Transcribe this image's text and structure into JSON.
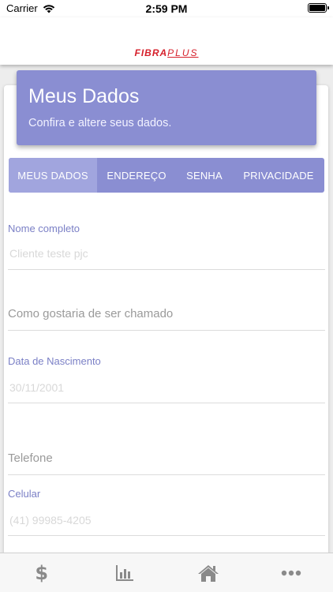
{
  "status_bar": {
    "carrier": "Carrier",
    "time": "2:59 PM"
  },
  "header": {
    "logo_main": "FIBRA",
    "logo_plus": "PLUS",
    "brand_color": "#d6202b"
  },
  "banner": {
    "title": "Meus Dados",
    "subtitle": "Confira e altere seus dados.",
    "color": "#8a8ed2"
  },
  "tabs": [
    {
      "label": "MEUS DADOS",
      "active": true
    },
    {
      "label": "ENDEREÇO",
      "active": false
    },
    {
      "label": "SENHA",
      "active": false
    },
    {
      "label": "PRIVACIDADE",
      "active": false
    }
  ],
  "form": {
    "full_name": {
      "label": "Nome completo",
      "value": "Cliente teste pjc"
    },
    "nickname": {
      "placeholder": "Como gostaria de ser chamado"
    },
    "birth_date": {
      "label": "Data de Nascimento",
      "value": "30/11/2001"
    },
    "phone": {
      "placeholder": "Telefone"
    },
    "mobile": {
      "label": "Celular",
      "value": "(41) 99985-4205"
    }
  },
  "tabbar": {
    "items": [
      {
        "icon": "dollar-icon"
      },
      {
        "icon": "bar-chart-icon"
      },
      {
        "icon": "home-icon"
      },
      {
        "icon": "more-icon"
      }
    ]
  }
}
